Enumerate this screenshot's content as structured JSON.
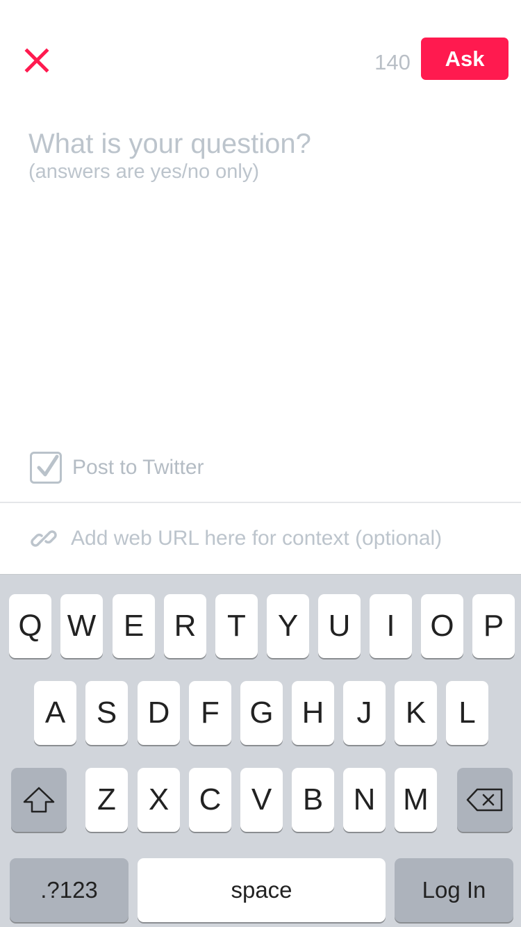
{
  "header": {
    "close_icon": "close-x-icon",
    "char_count": "140",
    "ask_label": "Ask",
    "accent": "#ff1a4f"
  },
  "question": {
    "placeholder": "What is your question?",
    "hint": "(answers are yes/no only)"
  },
  "twitter": {
    "label": "Post to Twitter",
    "checked": true
  },
  "url": {
    "icon": "link-icon",
    "placeholder": "Add web URL here for context (optional)"
  },
  "keyboard": {
    "row1": [
      "Q",
      "W",
      "E",
      "R",
      "T",
      "Y",
      "U",
      "I",
      "O",
      "P"
    ],
    "row2": [
      "A",
      "S",
      "D",
      "F",
      "G",
      "H",
      "J",
      "K",
      "L"
    ],
    "row3": [
      "Z",
      "X",
      "C",
      "V",
      "B",
      "N",
      "M"
    ],
    "shift_icon": "shift-arrow-icon",
    "backspace_icon": "backspace-icon",
    "numbers_label": ".?123",
    "space_label": "space",
    "return_label": "Log In"
  }
}
